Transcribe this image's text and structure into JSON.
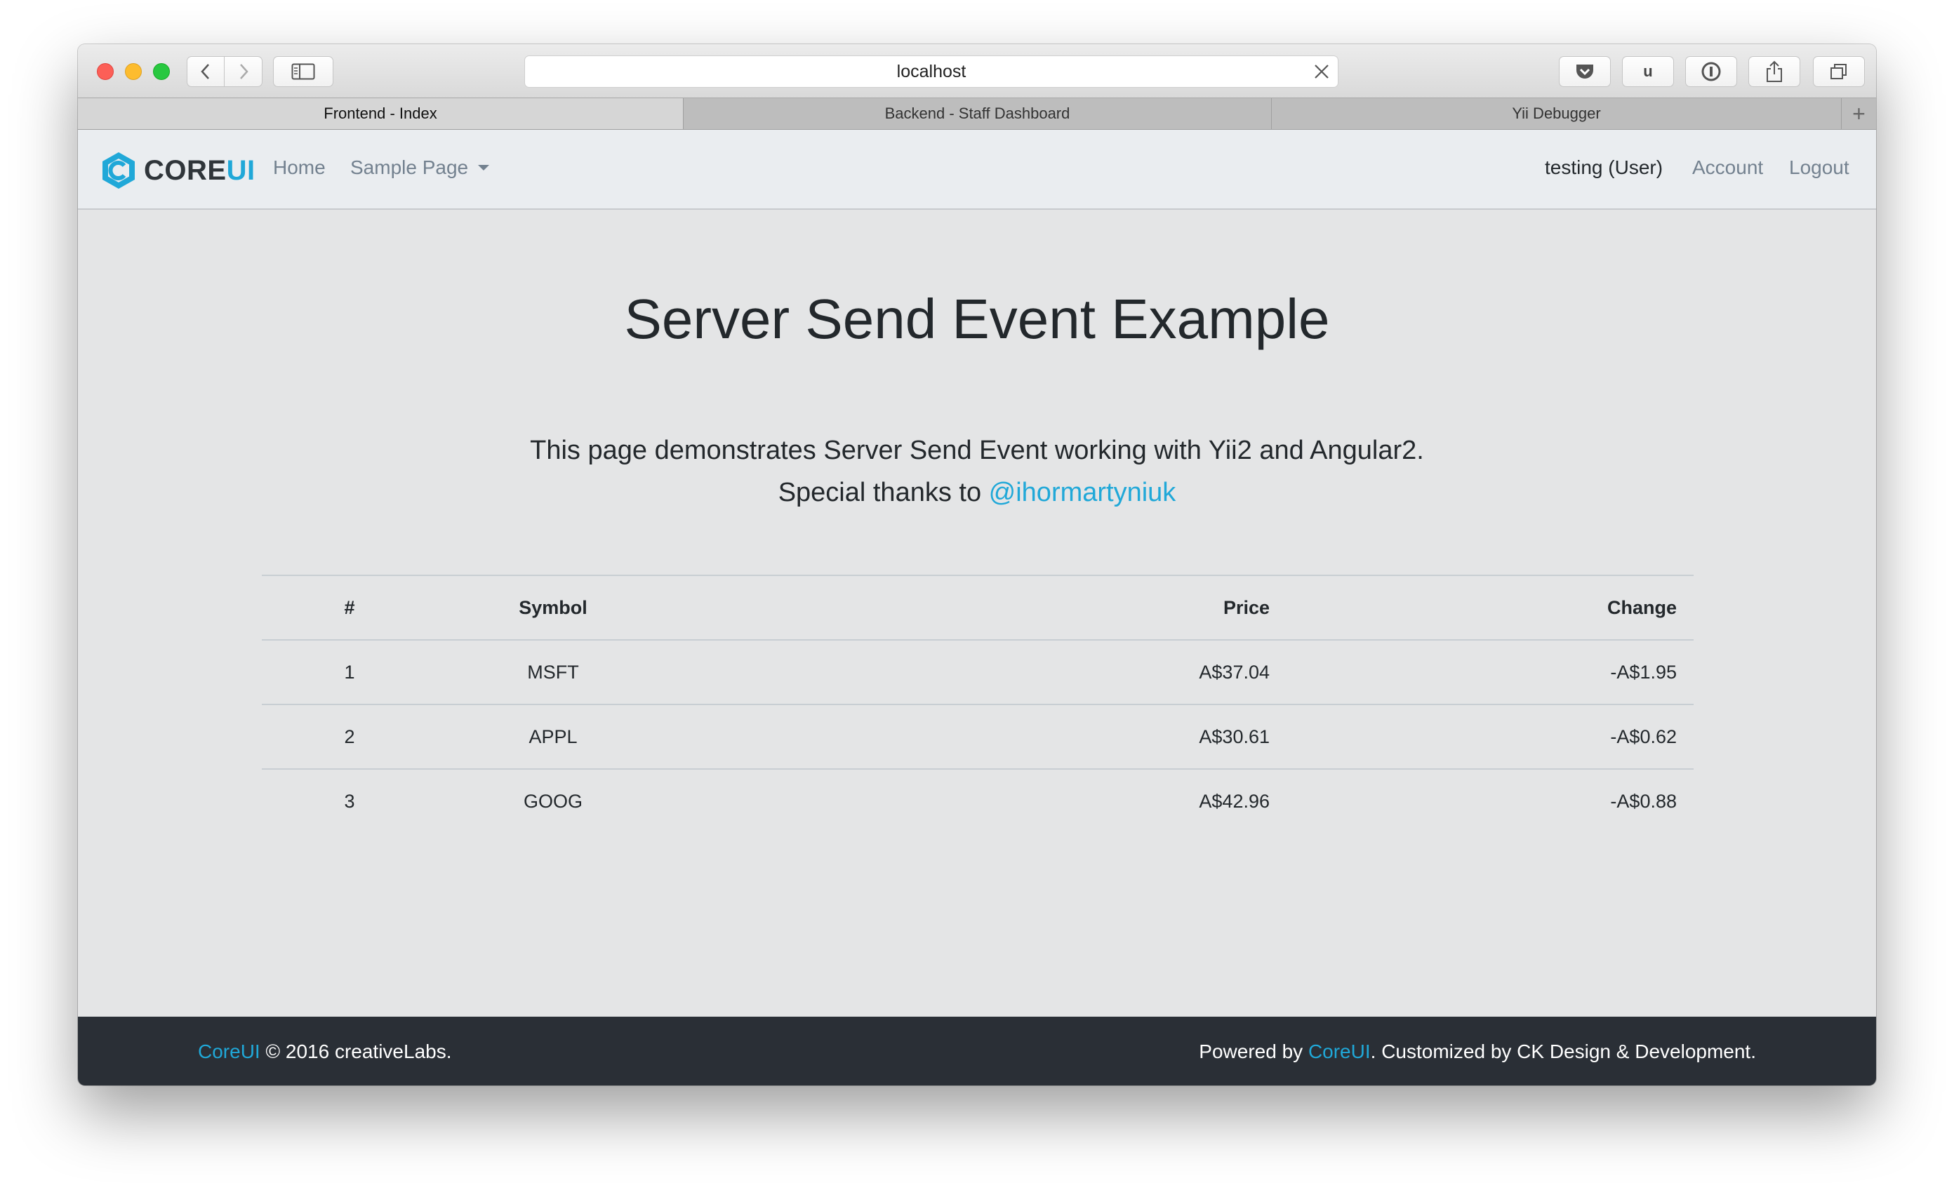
{
  "browser": {
    "url": "localhost",
    "ublock_label": "u",
    "tabs": [
      {
        "label": "Frontend - Index",
        "active": true
      },
      {
        "label": "Backend - Staff Dashboard",
        "active": false
      },
      {
        "label": "Yii Debugger",
        "active": false
      }
    ],
    "new_tab_label": "+"
  },
  "navbar": {
    "brand_core": "CORE",
    "brand_ui": "UI",
    "links": {
      "home": "Home",
      "sample_page": "Sample Page"
    },
    "user": "testing (User)",
    "account": "Account",
    "logout": "Logout"
  },
  "main": {
    "title": "Server Send Event Example",
    "lead_line1": "This page demonstrates Server Send Event working with Yii2 and Angular2.",
    "lead_line2_prefix": "Special thanks to ",
    "lead_link": "@ihormartyniuk",
    "table": {
      "headers": [
        "#",
        "Symbol",
        "Price",
        "Change"
      ],
      "rows": [
        [
          "1",
          "MSFT",
          "A$37.04",
          "-A$1.95"
        ],
        [
          "2",
          "APPL",
          "A$30.61",
          "-A$0.62"
        ],
        [
          "3",
          "GOOG",
          "A$42.96",
          "-A$0.88"
        ]
      ]
    }
  },
  "footer": {
    "left_link": "CoreUI",
    "left_text": " © 2016 creativeLabs.",
    "right_prefix": "Powered by ",
    "right_link": "CoreUI",
    "right_suffix": ". Customized by CK Design & Development."
  },
  "colors": {
    "accent": "#20a8d8",
    "footer_bg": "#2a2f36",
    "content_bg": "#e4e5e6",
    "navbar_bg": "#eaedf0"
  }
}
